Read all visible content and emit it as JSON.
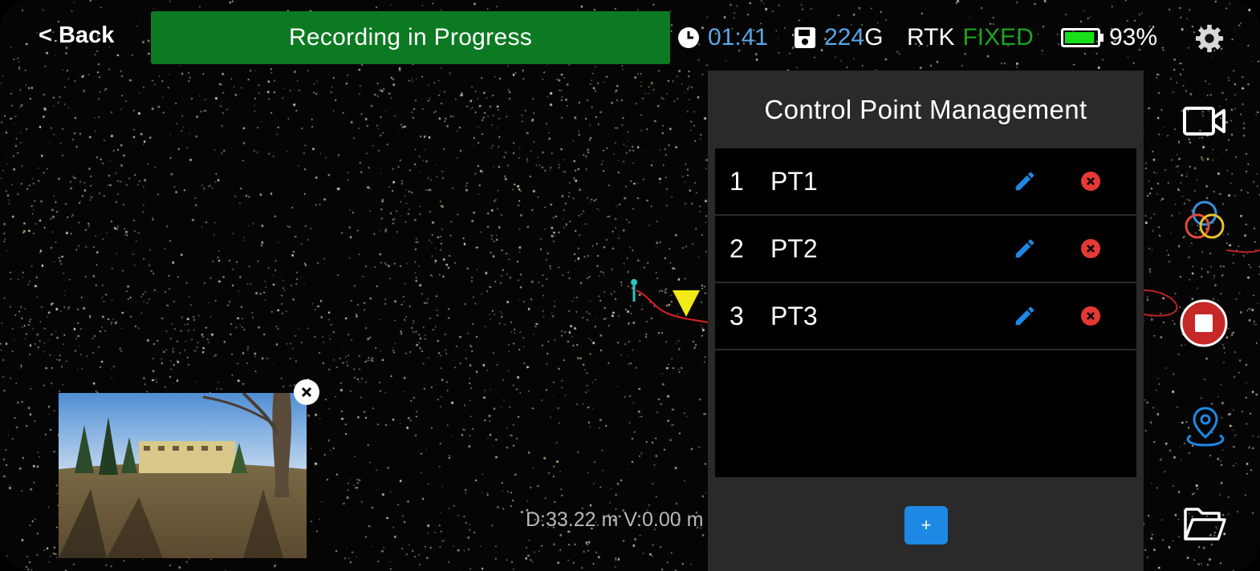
{
  "header": {
    "back_label": "< Back",
    "recording_banner": "Recording in Progress",
    "timer": "01:41",
    "storage_value": "224",
    "storage_unit": "G",
    "rtk_label": "RTK",
    "rtk_status": "FIXED",
    "battery_percent_text": "93%",
    "battery_level": 0.93
  },
  "panel": {
    "title": "Control Point Management",
    "points": [
      {
        "index": "1",
        "name": "PT1"
      },
      {
        "index": "2",
        "name": "PT2"
      },
      {
        "index": "3",
        "name": "PT3"
      }
    ],
    "add_label": "+"
  },
  "readout": "D:33.22 m V:0.00 m",
  "icons": {
    "clock": "clock-icon",
    "storage": "sd-card-icon",
    "battery": "battery-icon",
    "settings": "gear-icon",
    "video": "video-camera-icon",
    "color_mode": "rgb-circles-icon",
    "stop": "stop-record-icon",
    "location": "map-pin-icon",
    "folder": "folder-icon",
    "edit": "pencil-icon",
    "delete": "delete-x-icon",
    "close": "close-icon"
  },
  "colors": {
    "banner_green": "#0c7a22",
    "accent_blue": "#1e88e5",
    "status_blue": "#5aa7e8",
    "fixed_green": "#1fa21f",
    "delete_red": "#e53935",
    "stop_red": "#c62828",
    "panel_bg": "#2a2a2a"
  }
}
